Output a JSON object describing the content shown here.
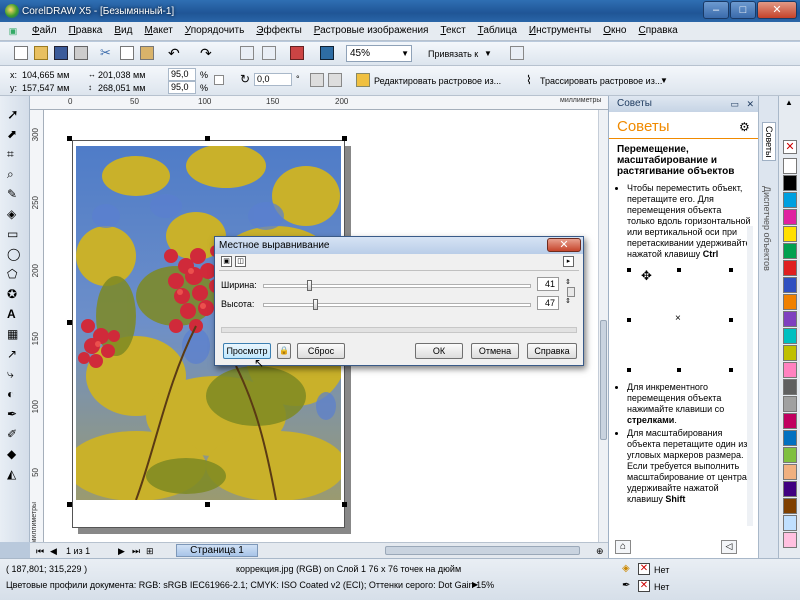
{
  "window": {
    "title": "CorelDRAW X5 - [Безымянный-1]",
    "minimize": "–",
    "maximize": "□",
    "close": "✕"
  },
  "menu": [
    "Файл",
    "Правка",
    "Вид",
    "Макет",
    "Упорядочить",
    "Эффекты",
    "Растровые изображения",
    "Текст",
    "Таблица",
    "Инструменты",
    "Окно",
    "Справка"
  ],
  "toolbar": {
    "zoom": "45%",
    "snap": "Привязать к"
  },
  "props": {
    "x": "104,665 мм",
    "y": "157,547 мм",
    "w": "201,038 мм",
    "h": "268,051 мм",
    "sx": "95,0",
    "sy": "95,0",
    "pct": "%",
    "angle": "0,0",
    "deg": "°",
    "edit_bitmap": "Редактировать растровое из...",
    "trace_bitmap": "Трассировать растровое из..."
  },
  "ruler": {
    "h_labels": [
      "0",
      "50",
      "100",
      "150",
      "200"
    ],
    "v_labels": [
      "300",
      "250",
      "200",
      "150",
      "100",
      "50"
    ],
    "units_h": "миллиметры",
    "units_v": "миллиметры"
  },
  "dialog": {
    "title": "Местное выравнивание",
    "width_label": "Ширина:",
    "height_label": "Высота:",
    "width_value": "41",
    "height_value": "47",
    "width_max": 255,
    "height_max": 255,
    "preview": "Просмотр",
    "reset": "Сброс",
    "ok": "ОК",
    "cancel": "Отмена",
    "help": "Справка"
  },
  "docker": {
    "header": "Советы",
    "title": "Советы",
    "heading": "Перемещение, масштабирование и растягивание объектов",
    "tip1": "Чтобы переместить объект, перетащите его. Для перемещения объекта только вдоль горизонтальной или вертикальной оси при перетаскивании удерживайте нажатой клавишу",
    "tip1_key": "Ctrl",
    "tip2": "Для инкрементного перемещения объекта нажимайте клавиши со",
    "tip2_key": "стрелками",
    "tip3": "Для масштабирования объекта перетащите один из угловых маркеров размера. Если требуется выполнить масштабирование от центра, удерживайте нажатой клавишу",
    "tip3_key": "Shift",
    "tab_tips": "Советы",
    "tab_object_manager": "Диспетчер объектов"
  },
  "pagenav": {
    "counter": "1 из 1",
    "tab": "Страница 1"
  },
  "status": {
    "coords": "( 187,801; 315,229 )",
    "object_info": "коррекция.jpg (RGB) on Слой 1 76 x 76 точек на дюйм",
    "color_profile": "Цветовые профили документа: RGB: sRGB IEC61966-2.1; CMYK: ISO Coated v2 (ECI); Оттенки серого: Dot Gain 15%",
    "fill_none": "Нет",
    "outline_none": "Нет"
  },
  "palette_colors": [
    "#ffffff",
    "#000000",
    "#00a0e0",
    "#e020a0",
    "#ffe000",
    "#00a050",
    "#e02020",
    "#3050c0",
    "#f08000",
    "#8040c0",
    "#00c0c0",
    "#c0c000",
    "#ff80c0",
    "#606060",
    "#a0a0a0",
    "#c00060",
    "#0070c0",
    "#80c040",
    "#f0b080",
    "#400080",
    "#804000",
    "#c0e0ff",
    "#ffc0e0"
  ]
}
